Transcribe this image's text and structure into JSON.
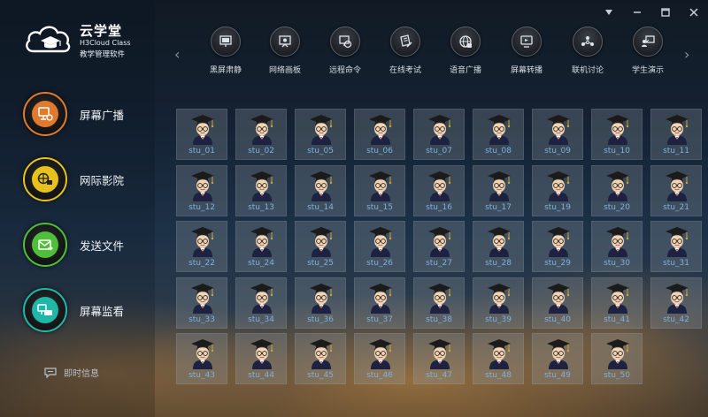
{
  "app": {
    "name": "云学堂",
    "name_en": "H3Cloud Class",
    "subtitle": "教学管理软件"
  },
  "window_controls": [
    "menu-dropdown-icon",
    "minimize-icon",
    "maximize-icon",
    "close-icon"
  ],
  "sidebar": {
    "items": [
      {
        "label": "屏幕广播",
        "icon": "screen-broadcast-icon",
        "color": "#e07a2e"
      },
      {
        "label": "网际影院",
        "icon": "cinema-icon",
        "color": "#e7c21f"
      },
      {
        "label": "发送文件",
        "icon": "send-file-icon",
        "color": "#4fbf3a"
      },
      {
        "label": "屏幕监看",
        "icon": "screen-monitor-icon",
        "color": "#1fb8a8"
      }
    ],
    "info_label": "即时信息"
  },
  "toolbar": {
    "tools": [
      {
        "label": "黑屏肃静",
        "icon": "black-screen-icon"
      },
      {
        "label": "网络画板",
        "icon": "whiteboard-icon"
      },
      {
        "label": "远程命令",
        "icon": "remote-command-icon"
      },
      {
        "label": "在线考试",
        "icon": "online-exam-icon"
      },
      {
        "label": "语音广播",
        "icon": "voice-broadcast-icon"
      },
      {
        "label": "屏幕转播",
        "icon": "screen-relay-icon"
      },
      {
        "label": "联机讨论",
        "icon": "online-discussion-icon"
      },
      {
        "label": "学生演示",
        "icon": "student-demo-icon"
      }
    ]
  },
  "students": [
    [
      "stu_01",
      "stu_02",
      "stu_05",
      "stu_06",
      "stu_07",
      "stu_08",
      "stu_09",
      "stu_10",
      "stu_11"
    ],
    [
      "stu_12",
      "stu_13",
      "stu_14",
      "stu_15",
      "stu_16",
      "stu_17",
      "stu_19",
      "stu_20",
      "stu_21"
    ],
    [
      "stu_22",
      "stu_24",
      "stu_25",
      "stu_26",
      "stu_27",
      "stu_28",
      "stu_29",
      "stu_30",
      "stu_31"
    ],
    [
      "stu_33",
      "stu_34",
      "stu_36",
      "stu_37",
      "stu_38",
      "stu_39",
      "stu_40",
      "stu_41",
      "stu_42"
    ],
    [
      "stu_43",
      "stu_44",
      "stu_45",
      "stu_46",
      "stu_47",
      "stu_48",
      "stu_49",
      "stu_50"
    ]
  ],
  "colors": {
    "student_label": "#7fb0dc",
    "accent": "#e07a2e"
  }
}
